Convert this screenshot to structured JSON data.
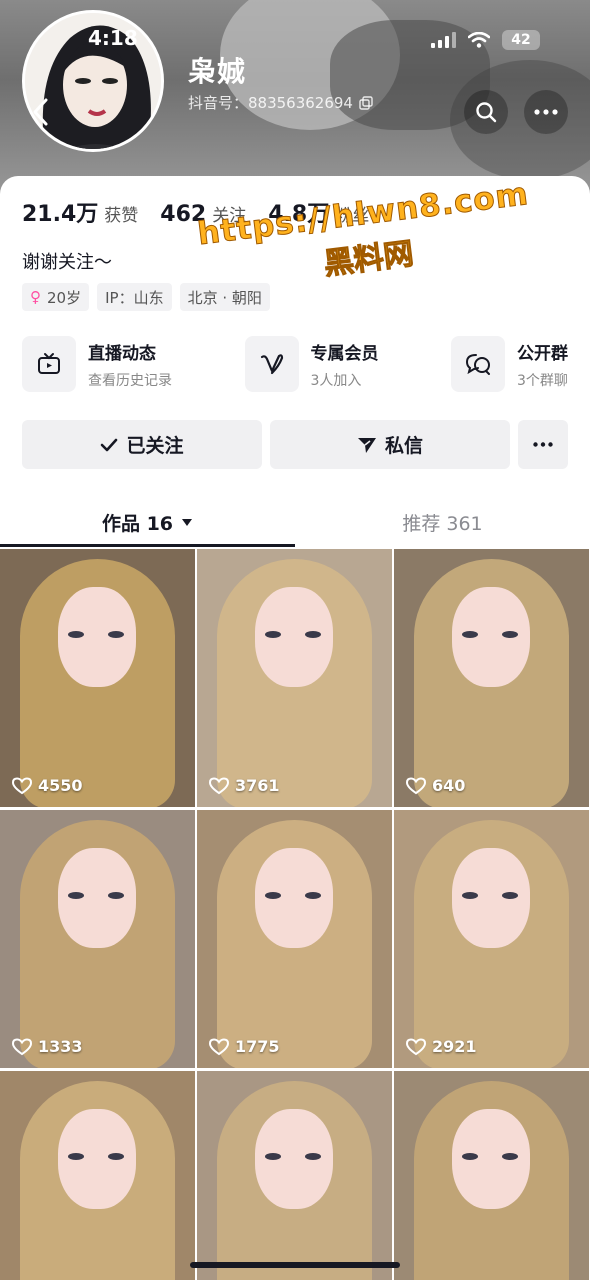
{
  "status_bar": {
    "time": "4:18",
    "battery": "42"
  },
  "profile": {
    "nickname": "枭娍",
    "douyin_id": "抖音号：88356362694",
    "stats": [
      {
        "num": "21.4万",
        "label": "获赞"
      },
      {
        "num": "462",
        "label": "关注"
      },
      {
        "num": "4.8万",
        "label": "粉丝"
      }
    ],
    "bio": "谢谢关注～",
    "tags": {
      "age": "20岁",
      "ip": "IP：山东",
      "location": "北京 · 朝阳"
    }
  },
  "features": [
    {
      "title": "直播动态",
      "sub": "查看历史记录",
      "icon": "tv-icon"
    },
    {
      "title": "专属会员",
      "sub": "3人加入",
      "icon": "heart-v-icon"
    },
    {
      "title": "公开群",
      "sub": "3个群聊",
      "icon": "chat-group-icon"
    }
  ],
  "actions": {
    "follow_label": "已关注",
    "message_label": "私信"
  },
  "tabs": {
    "works_label": "作品 16",
    "recommend_label": "推荐 361"
  },
  "videos": [
    {
      "likes": "4550",
      "hair": "#c9a766",
      "bg": "#7d6a55"
    },
    {
      "likes": "3761",
      "hair": "#d3b98a",
      "bg": "#b8a792"
    },
    {
      "likes": "640",
      "hair": "#cbb07e",
      "bg": "#8b7a66"
    },
    {
      "likes": "1333",
      "hair": "#c8a772",
      "bg": "#9a8c80"
    },
    {
      "likes": "1775",
      "hair": "#d2b585",
      "bg": "#a58e72"
    },
    {
      "likes": "2921",
      "hair": "#cdb080",
      "bg": "#b19a7e"
    },
    {
      "likes": "",
      "hair": "#d0b37f",
      "bg": "#a08769"
    },
    {
      "likes": "",
      "hair": "#ccb083",
      "bg": "#a99784"
    },
    {
      "likes": "",
      "hair": "#c7a877",
      "bg": "#9c8a74"
    }
  ],
  "watermark": {
    "url": "https://hlwn8.com",
    "text": "黑料网"
  }
}
